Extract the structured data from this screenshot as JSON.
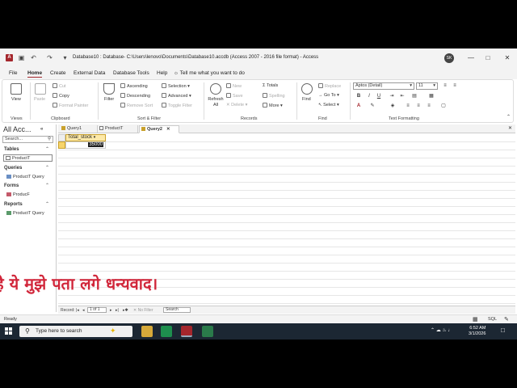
{
  "window": {
    "title": "Database10 : Database- C:\\Users\\lenovo\\Documents\\Database10.accdb (Access 2007 - 2016 file format) - Access",
    "user_initials": "SK"
  },
  "menu": {
    "tabs": [
      "File",
      "Home",
      "Create",
      "External Data",
      "Database Tools",
      "Help"
    ],
    "active": "Home",
    "tell_me": "Tell me what you want to do"
  },
  "ribbon": {
    "views": {
      "view": "View",
      "group": "Views"
    },
    "clipboard": {
      "paste": "Paste",
      "cut": "Cut",
      "copy": "Copy",
      "format_painter": "Format Painter",
      "group": "Clipboard"
    },
    "sort_filter": {
      "filter": "Filter",
      "ascending": "Ascending",
      "descending": "Descending",
      "remove_sort": "Remove Sort",
      "selection": "Selection",
      "advanced": "Advanced",
      "toggle_filter": "Toggle Filter",
      "group": "Sort & Filter"
    },
    "records": {
      "refresh_all": "Refresh All",
      "new": "New",
      "save": "Save",
      "delete": "Delete",
      "totals": "Totals",
      "spelling": "Spelling",
      "more": "More",
      "group": "Records"
    },
    "find": {
      "find": "Find",
      "replace": "Replace",
      "goto": "Go To",
      "select": "Select",
      "group": "Find"
    },
    "text_formatting": {
      "font": "Aptos (Detail)",
      "size": "11",
      "group": "Text Formatting"
    }
  },
  "nav": {
    "title": "All Acc...",
    "search_placeholder": "Search...",
    "sections": [
      {
        "label": "Tables",
        "items": [
          "ProductT"
        ]
      },
      {
        "label": "Queries",
        "items": [
          "ProductT Query"
        ]
      },
      {
        "label": "Forms",
        "items": [
          "ProducF"
        ]
      },
      {
        "label": "Reports",
        "items": [
          "ProductT Query"
        ]
      }
    ]
  },
  "doc_tabs": [
    "Query1",
    "ProductT",
    "Query2"
  ],
  "active_doc_tab": "Query2",
  "datasheet": {
    "column": "Total_stock",
    "values": [
      "35000"
    ]
  },
  "overlay_text": "है ये मुझे पता लगे धन्यवाद।",
  "record_nav": {
    "label": "Record:",
    "position": "1 of 1",
    "no_filter": "No Filter",
    "search": "Search"
  },
  "status": {
    "left": "Ready",
    "sql": "SQL"
  },
  "taskbar": {
    "search_placeholder": "Type here to search",
    "time": "6:52 AM",
    "date": "3/1/2026"
  },
  "colors": {
    "accent": "#a4262c",
    "highlight": "#fde9a8",
    "overlay": "#d1263a",
    "taskbar": "#1c2733"
  }
}
